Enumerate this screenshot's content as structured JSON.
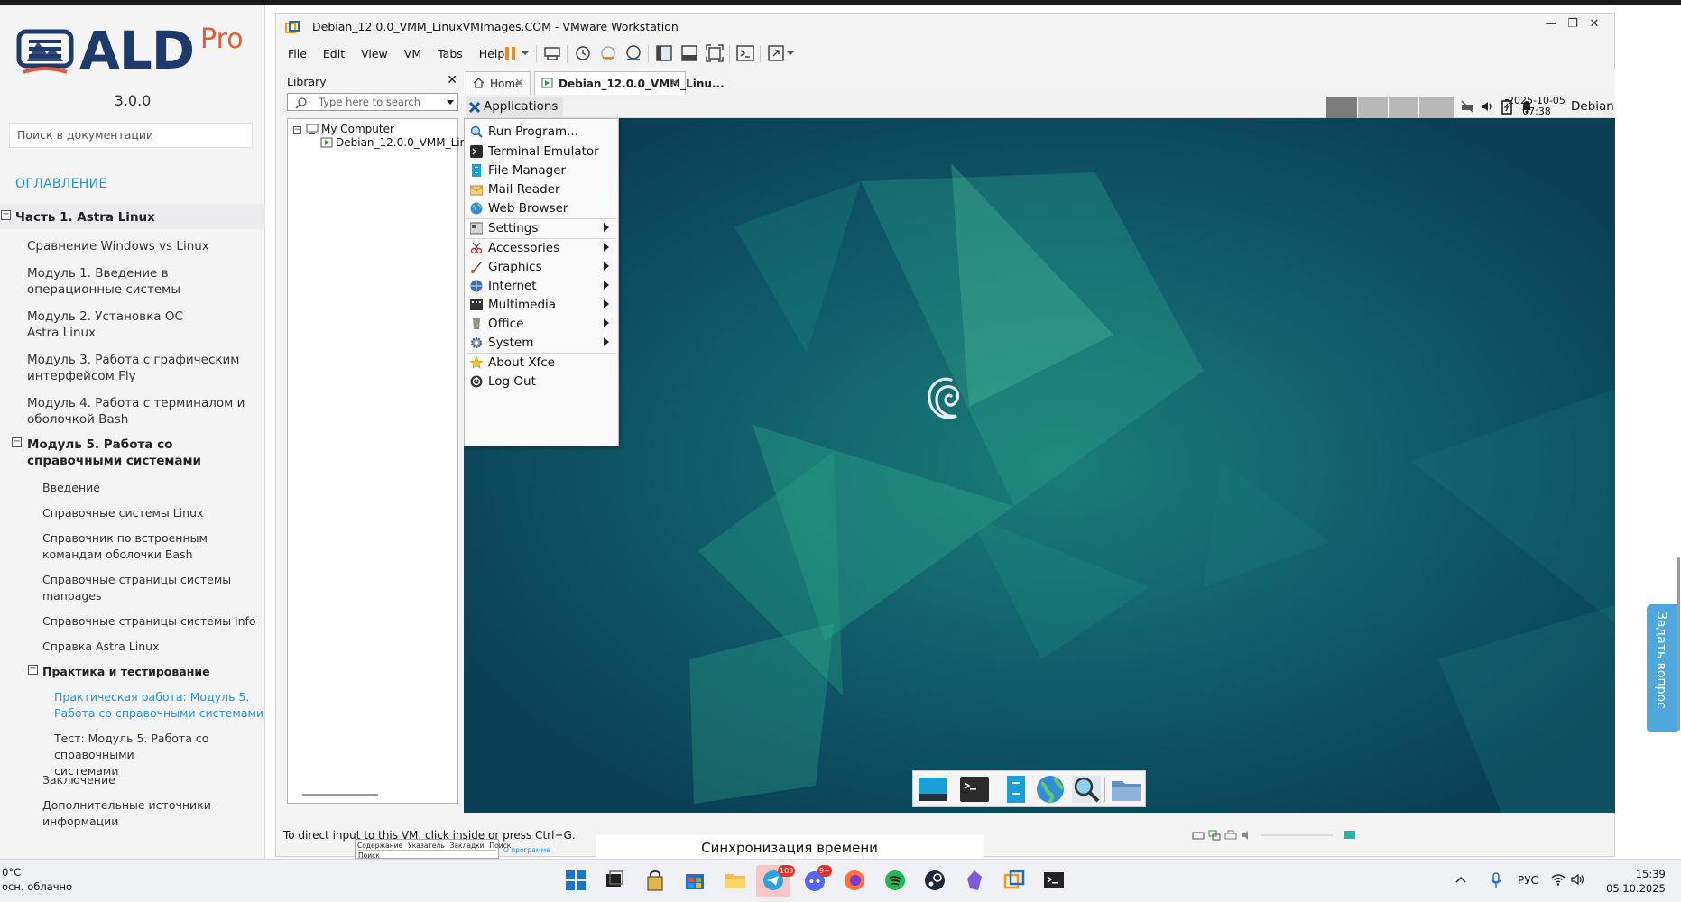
{
  "doc": {
    "logo_main": "ALD",
    "logo_sup": "Pro",
    "version": "3.0.0",
    "search_placeholder": "Поиск в документации",
    "toc_title": "ОГЛАВЛЕНИЕ",
    "items": [
      {
        "label": "Часть 1. Astra Linux"
      },
      {
        "label": "Сравнение Windows vs Linux"
      },
      {
        "label": "Модуль 1. Введение в операционные системы",
        "l1": "Модуль 1. Введение в",
        "l2": "операционные системы"
      },
      {
        "l1": "Модуль 2. Установка ОС",
        "l2": "Astra Linux"
      },
      {
        "l1": "Модуль 3. Работа с графическим",
        "l2": "интерфейсом Fly"
      },
      {
        "l1": "Модуль 4. Работа с терминалом и",
        "l2": "оболочкой Bash"
      },
      {
        "l1": "Модуль 5. Работа со",
        "l2": "справочными системами"
      },
      {
        "label": "Введение"
      },
      {
        "label": "Справочные системы Linux"
      },
      {
        "l1": "Справочник по встроенным",
        "l2": "командам оболочки Bash"
      },
      {
        "l1": "Справочные страницы системы",
        "l2": "manpages"
      },
      {
        "label": "Справочные страницы системы info"
      },
      {
        "label": "Справка Astra Linux"
      },
      {
        "label": "Практика и тестирование"
      },
      {
        "l1": "Практическая работа: Модуль 5.",
        "l2": "Работа со справочными системами"
      },
      {
        "l1": "Тест: Модуль 5. Работа со справочными",
        "l2": "системами"
      },
      {
        "label": "Заключение"
      },
      {
        "l1": "Дополнительные источники",
        "l2": "информации"
      }
    ]
  },
  "vmware": {
    "title": "Debian_12.0.0_VMM_LinuxVMImages.COM - VMware Workstation",
    "menu": [
      "File",
      "Edit",
      "View",
      "VM",
      "Tabs",
      "Help"
    ],
    "library_title": "Library",
    "library_search_placeholder": "Type here to search",
    "tree_root": "My Computer",
    "tree_vm": "Debian_12.0.0_VMM_Lin",
    "tabs": [
      {
        "label": "Home"
      },
      {
        "label": "Debian_12.0.0_VMM_Linu..."
      }
    ],
    "status_message": "To direct input to this VM, click inside or press Ctrl+G."
  },
  "guest": {
    "applications_label": "Applications",
    "clock_date": "2025-10-05",
    "clock_time": "07:38",
    "hostname": "Debian",
    "menu_items": [
      {
        "label": "Run Program...",
        "icon": "run-icon",
        "submenu": false
      },
      {
        "label": "Terminal Emulator",
        "icon": "terminal-icon",
        "submenu": false
      },
      {
        "label": "File Manager",
        "icon": "file-manager-icon",
        "submenu": false
      },
      {
        "label": "Mail Reader",
        "icon": "mail-icon",
        "submenu": false
      },
      {
        "label": "Web Browser",
        "icon": "globe-icon",
        "submenu": false
      },
      {
        "label": "Settings",
        "icon": "settings-icon",
        "submenu": true
      },
      {
        "label": "Accessories",
        "icon": "accessories-icon",
        "submenu": true
      },
      {
        "label": "Graphics",
        "icon": "graphics-icon",
        "submenu": true
      },
      {
        "label": "Internet",
        "icon": "internet-icon",
        "submenu": true
      },
      {
        "label": "Multimedia",
        "icon": "multimedia-icon",
        "submenu": true
      },
      {
        "label": "Office",
        "icon": "office-icon",
        "submenu": true
      },
      {
        "label": "System",
        "icon": "system-icon",
        "submenu": true
      },
      {
        "label": "About Xfce",
        "icon": "star-icon",
        "submenu": false
      },
      {
        "label": "Log Out",
        "icon": "logout-icon",
        "submenu": false
      }
    ]
  },
  "bottom": {
    "help_tabs": [
      "Содержание",
      "Указатель",
      "Закладки",
      "Поиск"
    ],
    "help_sub": "Поиск",
    "help_about": "О программе",
    "sync_title": "Синхронизация времени"
  },
  "ask_button": "Задать вопрос",
  "taskbar": {
    "weather_temp": "0°C",
    "weather_desc": "осн. облачно",
    "lang": "РУС",
    "time": "15:39",
    "date": "05.10.2025",
    "telegram_badge": "103",
    "discord_badge": "9+"
  },
  "colors": {
    "accent_blue": "#2b8fd6",
    "ald_navy": "#1d3a6b",
    "ald_orange": "#e15d3a",
    "desktop_teal": "#0d4e62"
  }
}
